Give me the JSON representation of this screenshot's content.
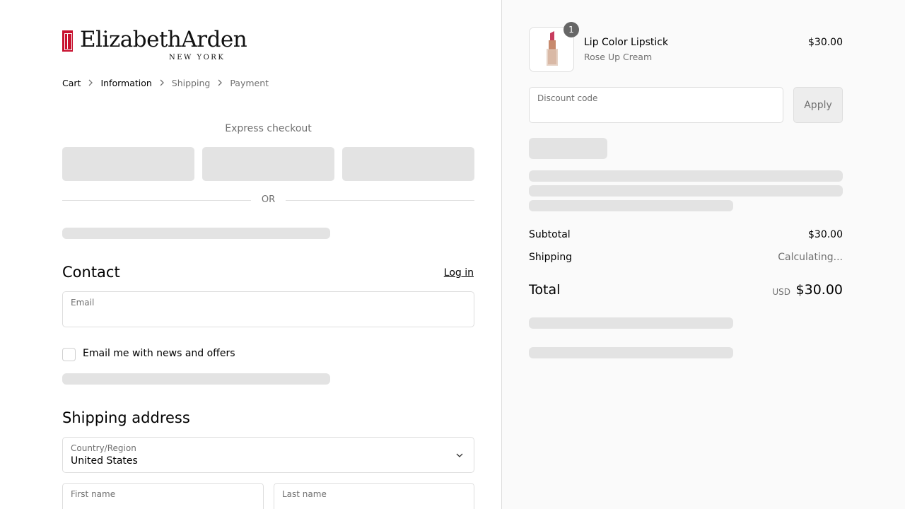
{
  "brand": {
    "name": "ElizabethArden",
    "subtitle": "NEW YORK",
    "accent_color": "#c8102e"
  },
  "breadcrumb": {
    "items": [
      "Cart",
      "Information",
      "Shipping",
      "Payment"
    ],
    "separator_icon": "chevron-right-icon"
  },
  "express": {
    "title": "Express checkout"
  },
  "divider": {
    "label": "OR"
  },
  "contact": {
    "title": "Contact",
    "login_label": "Log in",
    "email_label": "Email",
    "email_value": "",
    "newsletter_label": "Email me with news and offers",
    "newsletter_checked": false
  },
  "shipping": {
    "title": "Shipping address",
    "country_label": "Country/Region",
    "country_value": "United States",
    "first_name_label": "First name",
    "last_name_label": "Last name"
  },
  "order": {
    "item": {
      "quantity": "1",
      "name": "Lip Color Lipstick",
      "variant": "Rose Up Cream",
      "price": "$30.00"
    },
    "discount_label": "Discount code",
    "apply_label": "Apply",
    "subtotal_label": "Subtotal",
    "subtotal_value": "$30.00",
    "shipping_label": "Shipping",
    "shipping_value": "Calculating...",
    "total_label": "Total",
    "total_currency": "USD",
    "total_value": "$30.00"
  }
}
